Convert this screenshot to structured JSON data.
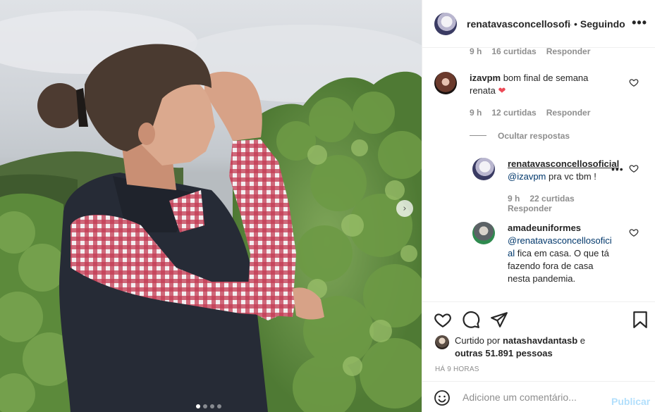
{
  "post": {
    "username": "renatavasconcellosoficial",
    "separator": "•",
    "follow_status": "Seguindo",
    "more_glyph": "•••"
  },
  "photo": {
    "next_glyph": "›",
    "carousel_count": 4,
    "carousel_active": 0
  },
  "comments": [
    {
      "time": "9 h",
      "likes": "16 curtidas",
      "reply_label": "Responder"
    },
    {
      "username": "izavpm",
      "text": "bom final de semana renata",
      "emoji": "❤",
      "time": "9 h",
      "likes": "12 curtidas",
      "reply_label": "Responder",
      "like_icon": "heart-outline-icon"
    }
  ],
  "hide_replies": "Ocultar respostas",
  "replies": [
    {
      "username": "renatavasconcellosoficial",
      "mention": "@izavpm",
      "text": "pra vc tbm !",
      "time": "9 h",
      "likes": "22 curtidas",
      "reply_label": "Responder",
      "more": "•••"
    },
    {
      "username": "amadeuniformes",
      "mention_line1": "@renatavasconcellosofici",
      "mention_line2": "al",
      "text_line2": "fica em casa. O que tá",
      "text_line3": "fazendo fora de casa",
      "text_line4": "nesta pandemia."
    }
  ],
  "actions": {
    "like_icon": "heart-outline-icon",
    "comment_icon": "comment-bubble-icon",
    "share_icon": "paper-plane-icon",
    "save_icon": "bookmark-icon"
  },
  "likes_summary": {
    "prefix": "Curtido por",
    "user": "natashavdantasb",
    "joiner": "e",
    "others": "outras 51.891 pessoas"
  },
  "time_ago": "HÁ 9 HORAS",
  "add_comment": {
    "placeholder": "Adicione um comentário...",
    "publish_label": "Publicar"
  },
  "colors": {
    "text": "#262626",
    "muted": "#8e8e8e",
    "link": "#00376b",
    "publish_disabled": "#b2dffc",
    "heart_red": "#ed4956"
  }
}
